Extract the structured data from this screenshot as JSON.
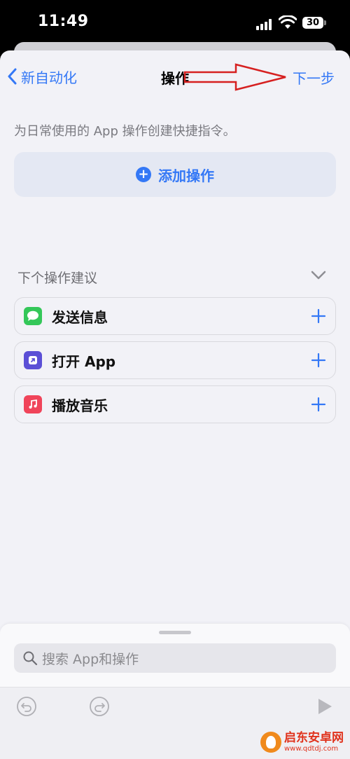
{
  "status_bar": {
    "time": "11:49",
    "battery": "30"
  },
  "nav": {
    "back_label": "新自动化",
    "title": "操作",
    "next_label": "下一步"
  },
  "description": "为日常使用的 App 操作创建快捷指令。",
  "add_action": {
    "label": "添加操作"
  },
  "suggestions": {
    "header": "下个操作建议",
    "items": [
      {
        "label": "发送信息",
        "icon": "messages-icon",
        "color": "#34c759"
      },
      {
        "label": "打开 App",
        "icon": "open-app-icon",
        "color": "#5b4fd6"
      },
      {
        "label": "播放音乐",
        "icon": "music-icon",
        "color": "#f0445a"
      }
    ]
  },
  "search": {
    "placeholder": "搜索 App和操作"
  },
  "watermark": {
    "title": "启东安卓网",
    "url": "www.qdtdj.com"
  },
  "colors": {
    "accent": "#3478f6",
    "background": "#f2f2f7",
    "annotation": "#d62020"
  }
}
